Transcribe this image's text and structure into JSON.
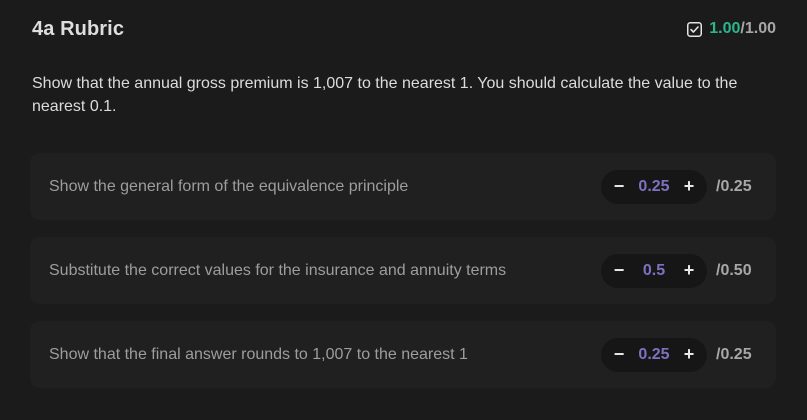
{
  "rubric": {
    "title": "4a Rubric",
    "score_earned": "1.00",
    "score_max": "/1.00",
    "status_icon": "checkbox-checked-icon",
    "colors": {
      "earned": "#2bb58a",
      "step_value": "#7c72c0"
    }
  },
  "question": {
    "text": "Show that the annual gross premium is 1,007 to the nearest 1. You should calculate the value to the nearest 0.1."
  },
  "criteria": [
    {
      "label": "Show the general form of the equivalence principle",
      "decrement": "−",
      "value": "0.25",
      "increment": "+",
      "max": "/0.25"
    },
    {
      "label": "Substitute the correct values for the insurance and annuity terms",
      "decrement": "−",
      "value": "0.5",
      "increment": "+",
      "max": "/0.50"
    },
    {
      "label": "Show that the final answer rounds to 1,007 to the nearest 1",
      "decrement": "−",
      "value": "0.25",
      "increment": "+",
      "max": "/0.25"
    }
  ]
}
